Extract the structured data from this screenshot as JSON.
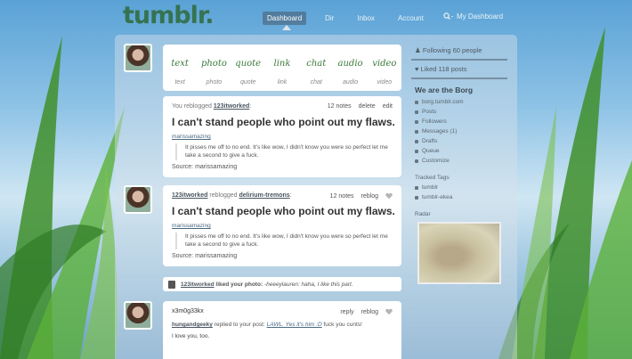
{
  "header": {
    "logo": "tumblr.",
    "nav": [
      {
        "label": "Dashboard",
        "active": true
      },
      {
        "label": "Dir",
        "active": false
      },
      {
        "label": "Inbox",
        "active": false
      },
      {
        "label": "Account",
        "active": false
      }
    ],
    "search_label": "My Dashboard"
  },
  "post_types": [
    {
      "script": "text",
      "label": "text"
    },
    {
      "script": "photo",
      "label": "photo"
    },
    {
      "script": "quote",
      "label": "quote"
    },
    {
      "script": "link",
      "label": "link"
    },
    {
      "script": "chat",
      "label": "chat"
    },
    {
      "script": "audio",
      "label": "audio"
    },
    {
      "script": "video",
      "label": "video"
    }
  ],
  "posts": [
    {
      "prefix": "You reblogged",
      "user": "123itworked",
      "suffix": ":",
      "actions": [
        "12 notes",
        "delete",
        "edit"
      ],
      "title": "I can't stand people who point out my flaws.",
      "source_user": "marissamazing",
      "quote": "It pisses me off to no end. It's like wow, I didn't know you were so perfect let me take a second to give a fuck.",
      "source": "Source: marissamazing"
    },
    {
      "user": "123itworked",
      "middle": "reblogged",
      "user2": "delirium-tremons",
      "suffix": ":",
      "actions": [
        "12 notes",
        "reblog"
      ],
      "title": "I can't stand people who point out my flaws.",
      "source_user": "marissamazing",
      "quote": "It pisses me off to no end. It's like wow, I didn't know you were so perfect let me take a second to give a fuck.",
      "source": "Source: marissamazing"
    }
  ],
  "liked": {
    "user": "123itworked",
    "text": "liked your photo:",
    "quote": "-heeeylauren: haha, I like this part."
  },
  "reply_post": {
    "user": "x3m0g33kx",
    "actions": [
      "reply",
      "reblog"
    ],
    "replier": "hungandgeeky",
    "reply_text": "replied to your post:",
    "reply_link": "LAWL. Yes it's him :D",
    "reply_tail": "fuck you cunts!",
    "body": "I love you, too."
  },
  "sidebar": {
    "following": "Following 60 people",
    "likes": "Liked 118 posts",
    "blog_title": "We are the Borg",
    "links": [
      "borg.tumblr.com",
      "Posts",
      "Followers",
      "Messages (1)",
      "Drafts",
      "Queue",
      "Customize"
    ],
    "tracked_label": "Tracked Tags",
    "tags": [
      "tumblr",
      "tumblr-ekea"
    ],
    "radar_label": "Radar"
  },
  "colors": {
    "accent": "#3b7a3b",
    "logo": "#2f6a3a"
  }
}
